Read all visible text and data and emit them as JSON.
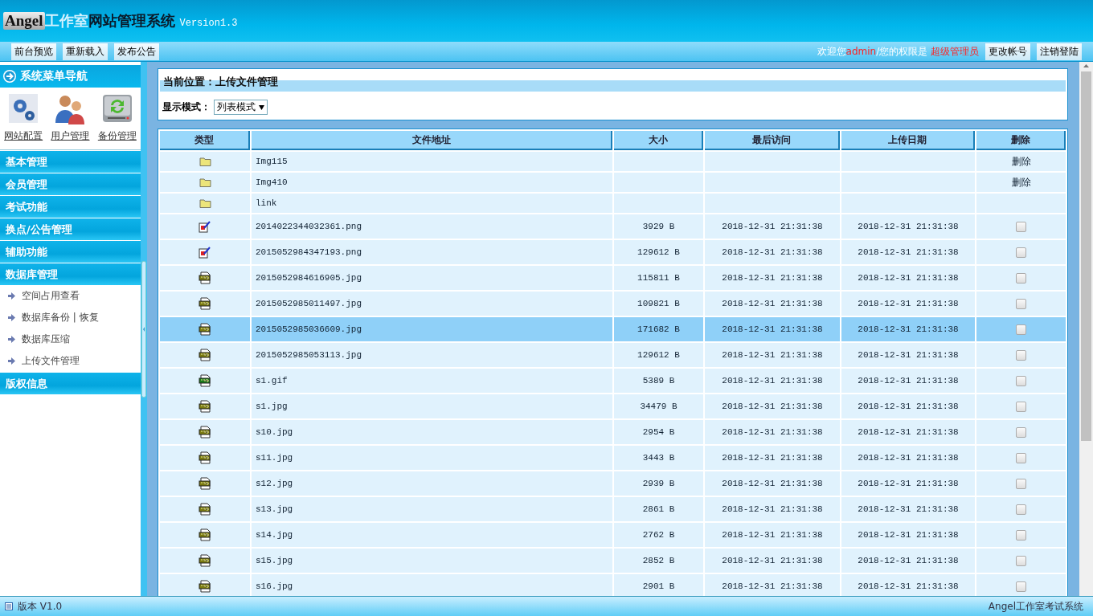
{
  "header": {
    "badge": "Angel",
    "studio": "工作室",
    "system": "网站管理系统",
    "version": "Version1.3"
  },
  "toolbar": {
    "buttons": [
      "前台预览",
      "重新载入",
      "发布公告"
    ],
    "welcome": [
      {
        "text": "欢迎您",
        "highlight": false
      },
      {
        "text": "admin",
        "highlight": true
      },
      {
        "text": "/您的权限是 ",
        "highlight": false
      },
      {
        "text": "超级管理员",
        "highlight": true
      }
    ],
    "account_buttons": [
      "更改帐号",
      "注销登陆"
    ]
  },
  "sidebar": {
    "title": "系统菜单导航",
    "shortcuts": [
      {
        "kind": "gears",
        "label": "网站配置"
      },
      {
        "kind": "users",
        "label": "用户管理"
      },
      {
        "kind": "backup",
        "label": "备份管理"
      }
    ],
    "sections": [
      {
        "label": "基本管理"
      },
      {
        "label": "会员管理"
      },
      {
        "label": "考试功能"
      },
      {
        "label": "换点/公告管理"
      },
      {
        "label": "辅助功能"
      },
      {
        "label": "数据库管理",
        "children": [
          {
            "label": "空间占用查看"
          },
          {
            "label": "数据库备份 | 恢复"
          },
          {
            "label": "数据库压缩"
          },
          {
            "label": "上传文件管理"
          }
        ]
      },
      {
        "label": "版权信息"
      }
    ]
  },
  "location": {
    "label": "当前位置：上传文件管理",
    "mode_label": "显示模式：",
    "mode_value": "列表模式"
  },
  "table": {
    "columns": [
      "类型",
      "文件地址",
      "大小",
      "最后访问",
      "上传日期",
      "删除"
    ],
    "rows": [
      {
        "kind": "folder",
        "name": "Img115",
        "action": "删除",
        "selected": false
      },
      {
        "kind": "folder",
        "name": "Img410",
        "action": "删除",
        "selected": false
      },
      {
        "kind": "folder",
        "name": "link",
        "selected": false
      },
      {
        "kind": "png",
        "name": "2014022344032361.png",
        "size": "3929 B",
        "accessed": "2018-12-31 21:31:38",
        "uploaded": "2018-12-31 21:31:38",
        "checked": false,
        "selected": false
      },
      {
        "kind": "png",
        "name": "2015052984347193.png",
        "size": "129612 B",
        "accessed": "2018-12-31 21:31:38",
        "uploaded": "2018-12-31 21:31:38",
        "checked": false,
        "selected": false
      },
      {
        "kind": "jpg",
        "name": "2015052984616905.jpg",
        "size": "115811 B",
        "accessed": "2018-12-31 21:31:38",
        "uploaded": "2018-12-31 21:31:38",
        "checked": false,
        "selected": false
      },
      {
        "kind": "jpg",
        "name": "2015052985011497.jpg",
        "size": "109821 B",
        "accessed": "2018-12-31 21:31:38",
        "uploaded": "2018-12-31 21:31:38",
        "checked": false,
        "selected": false
      },
      {
        "kind": "jpg",
        "name": "2015052985036609.jpg",
        "size": "171682 B",
        "accessed": "2018-12-31 21:31:38",
        "uploaded": "2018-12-31 21:31:38",
        "checked": false,
        "selected": true
      },
      {
        "kind": "jpg",
        "name": "2015052985053113.jpg",
        "size": "129612 B",
        "accessed": "2018-12-31 21:31:38",
        "uploaded": "2018-12-31 21:31:38",
        "checked": false,
        "selected": false
      },
      {
        "kind": "gif",
        "name": "s1.gif",
        "size": "5389 B",
        "accessed": "2018-12-31 21:31:38",
        "uploaded": "2018-12-31 21:31:38",
        "checked": false,
        "selected": false
      },
      {
        "kind": "jpg",
        "name": "s1.jpg",
        "size": "34479 B",
        "accessed": "2018-12-31 21:31:38",
        "uploaded": "2018-12-31 21:31:38",
        "checked": false,
        "selected": false
      },
      {
        "kind": "jpg",
        "name": "s10.jpg",
        "size": "2954 B",
        "accessed": "2018-12-31 21:31:38",
        "uploaded": "2018-12-31 21:31:38",
        "checked": false,
        "selected": false
      },
      {
        "kind": "jpg",
        "name": "s11.jpg",
        "size": "3443 B",
        "accessed": "2018-12-31 21:31:38",
        "uploaded": "2018-12-31 21:31:38",
        "checked": false,
        "selected": false
      },
      {
        "kind": "jpg",
        "name": "s12.jpg",
        "size": "2939 B",
        "accessed": "2018-12-31 21:31:38",
        "uploaded": "2018-12-31 21:31:38",
        "checked": false,
        "selected": false
      },
      {
        "kind": "jpg",
        "name": "s13.jpg",
        "size": "2861 B",
        "accessed": "2018-12-31 21:31:38",
        "uploaded": "2018-12-31 21:31:38",
        "checked": false,
        "selected": false
      },
      {
        "kind": "jpg",
        "name": "s14.jpg",
        "size": "2762 B",
        "accessed": "2018-12-31 21:31:38",
        "uploaded": "2018-12-31 21:31:38",
        "checked": false,
        "selected": false
      },
      {
        "kind": "jpg",
        "name": "s15.jpg",
        "size": "2852 B",
        "accessed": "2018-12-31 21:31:38",
        "uploaded": "2018-12-31 21:31:38",
        "checked": false,
        "selected": false
      },
      {
        "kind": "jpg",
        "name": "s16.jpg",
        "size": "2901 B",
        "accessed": "2018-12-31 21:31:38",
        "uploaded": "2018-12-31 21:31:38",
        "checked": false,
        "selected": false
      }
    ]
  },
  "status_bar": {
    "version": "版本 V1.0",
    "system": "Angel工作室考试系统"
  }
}
